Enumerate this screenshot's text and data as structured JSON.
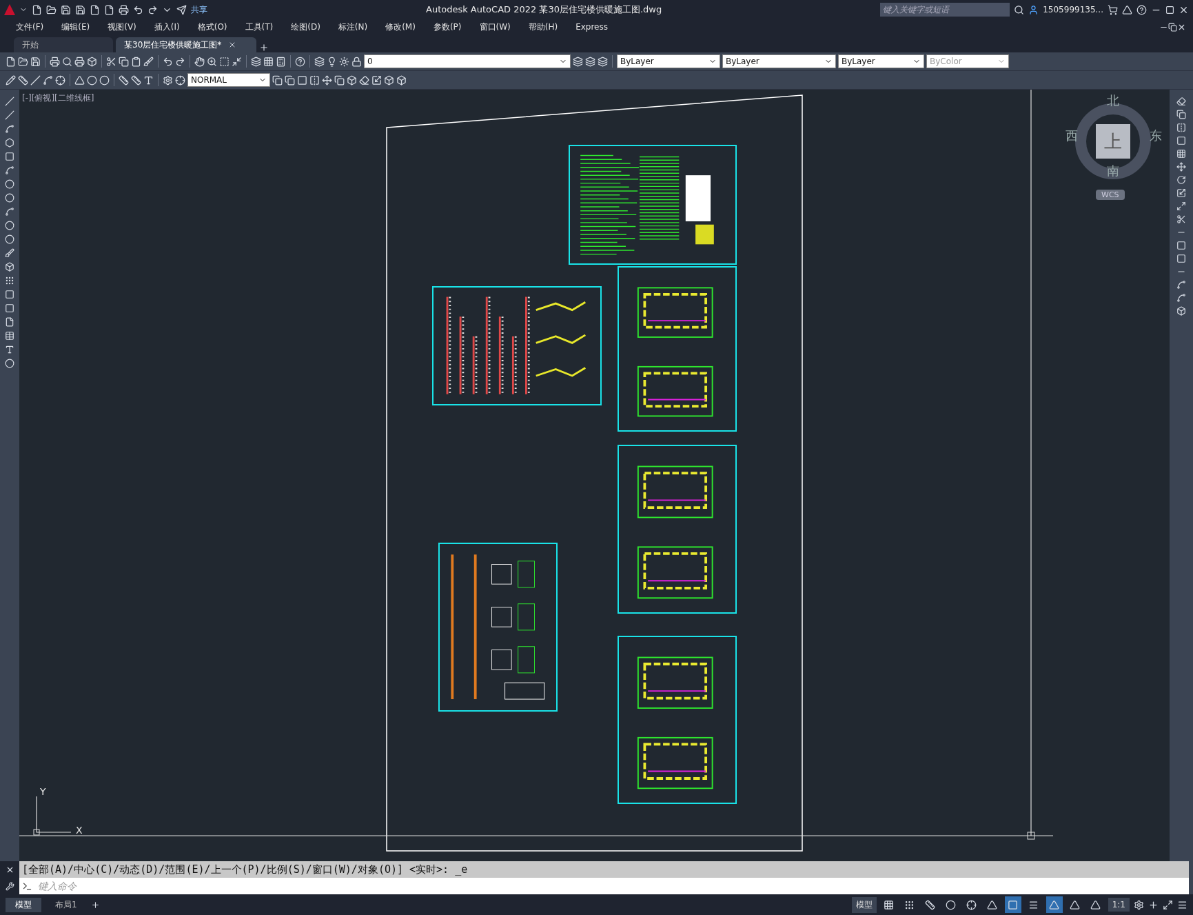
{
  "title_bar": {
    "title": "Autodesk AutoCAD 2022    某30层住宅楼供暖施工图.dwg",
    "share": "共享",
    "search": {
      "placeholder": "键入关键字或短语"
    },
    "user": "1505999135..."
  },
  "menu": [
    "文件(F)",
    "编辑(E)",
    "视图(V)",
    "插入(I)",
    "格式(O)",
    "工具(T)",
    "绘图(D)",
    "标注(N)",
    "修改(M)",
    "参数(P)",
    "窗口(W)",
    "帮助(H)",
    "Express"
  ],
  "tabs": [
    {
      "label": "开始",
      "selected": false
    },
    {
      "label": "某30层住宅楼供暖施工图*",
      "selected": true
    }
  ],
  "toolbar": {
    "layer": "0",
    "object_color": "ByLayer",
    "linetype": "ByLayer",
    "lineweight": "ByLayer",
    "plot_style": {
      "value": "ByColor",
      "disabled": true
    },
    "dim_style": "NORMAL"
  },
  "viewport": {
    "label": "[-][俯视][二维线框]",
    "viewcube": {
      "north": "北",
      "south": "南",
      "east": "东",
      "west": "西",
      "top": "上",
      "ucs": "WCS"
    },
    "ucs_x": "X",
    "ucs_y": "Y"
  },
  "command": {
    "history": "[全部(A)/中心(C)/动态(D)/范围(E)/上一个(P)/比例(S)/窗口(W)/对象(O)] <实时>: _e",
    "placeholder": "键入命令"
  },
  "layout_tabs": [
    {
      "label": "模型",
      "selected": true
    },
    {
      "label": "布局1",
      "selected": false
    }
  ],
  "status_bar": {
    "space": "模型",
    "scale": "1:1",
    "toggles": [
      {
        "on": false
      },
      {
        "on": false
      },
      {
        "on": false
      },
      {
        "on": false
      },
      {
        "on": false
      },
      {
        "on": false
      },
      {
        "on": true
      },
      {
        "on": false
      },
      {
        "on": true
      },
      {
        "on": false
      },
      {
        "on": false
      }
    ]
  }
}
